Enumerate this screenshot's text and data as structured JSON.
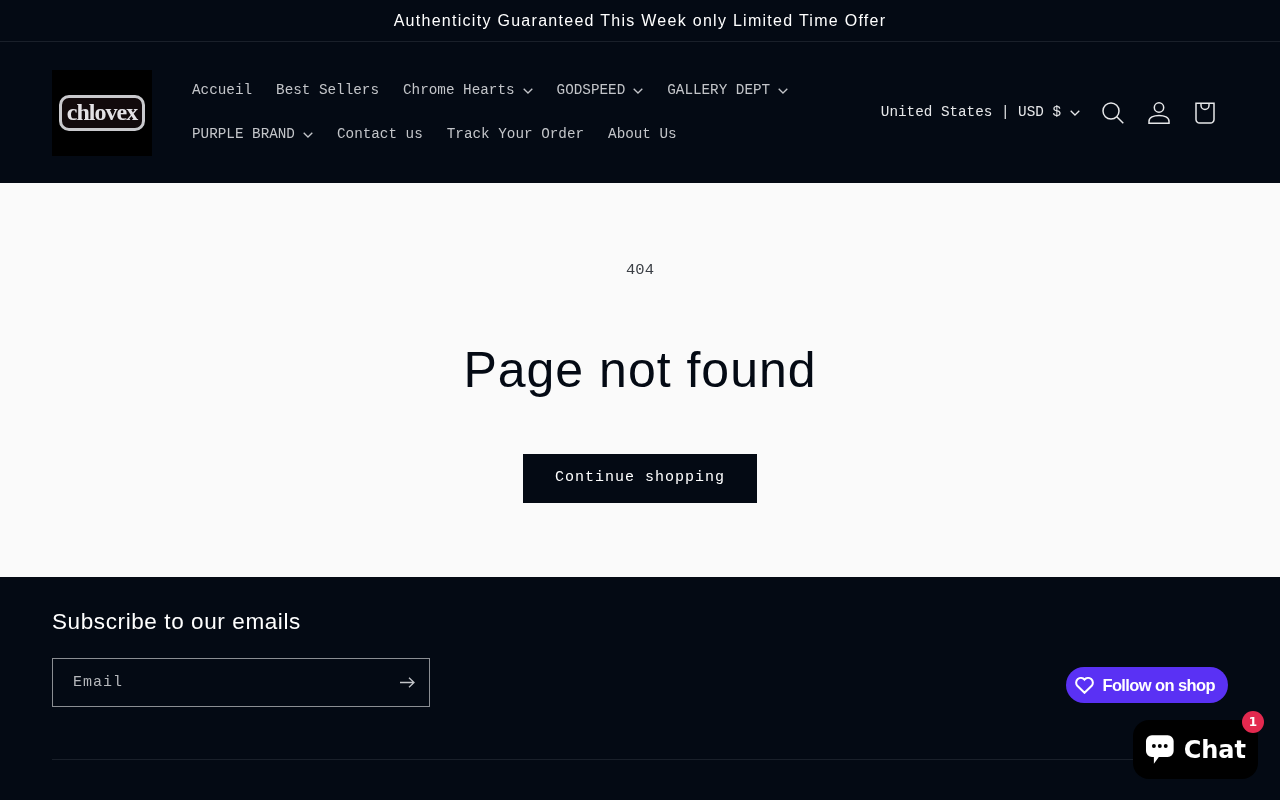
{
  "announcement": {
    "text": "Authenticity Guaranteed This Week only Limited Time Offer"
  },
  "header": {
    "logo": {
      "text": "chlovex"
    },
    "nav": [
      {
        "label": "Accueil",
        "dropdown": false
      },
      {
        "label": "Best Sellers",
        "dropdown": false
      },
      {
        "label": "Chrome Hearts",
        "dropdown": true
      },
      {
        "label": "GODSPEED",
        "dropdown": true
      },
      {
        "label": "GALLERY DEPT",
        "dropdown": true
      },
      {
        "label": "PURPLE BRAND",
        "dropdown": true
      },
      {
        "label": "Contact us",
        "dropdown": false
      },
      {
        "label": "Track Your Order",
        "dropdown": false
      },
      {
        "label": "About Us",
        "dropdown": false
      }
    ],
    "country_selector": {
      "label": "United States | USD $"
    }
  },
  "main": {
    "code": "404",
    "title": "Page not found",
    "button": "Continue shopping"
  },
  "footer": {
    "newsletter": {
      "heading": "Subscribe to our emails",
      "email": {
        "placeholder": "Email"
      }
    },
    "follow_button": {
      "label": "Follow on shop"
    }
  },
  "chat_widget": {
    "label": "Chat",
    "badge": "1"
  }
}
